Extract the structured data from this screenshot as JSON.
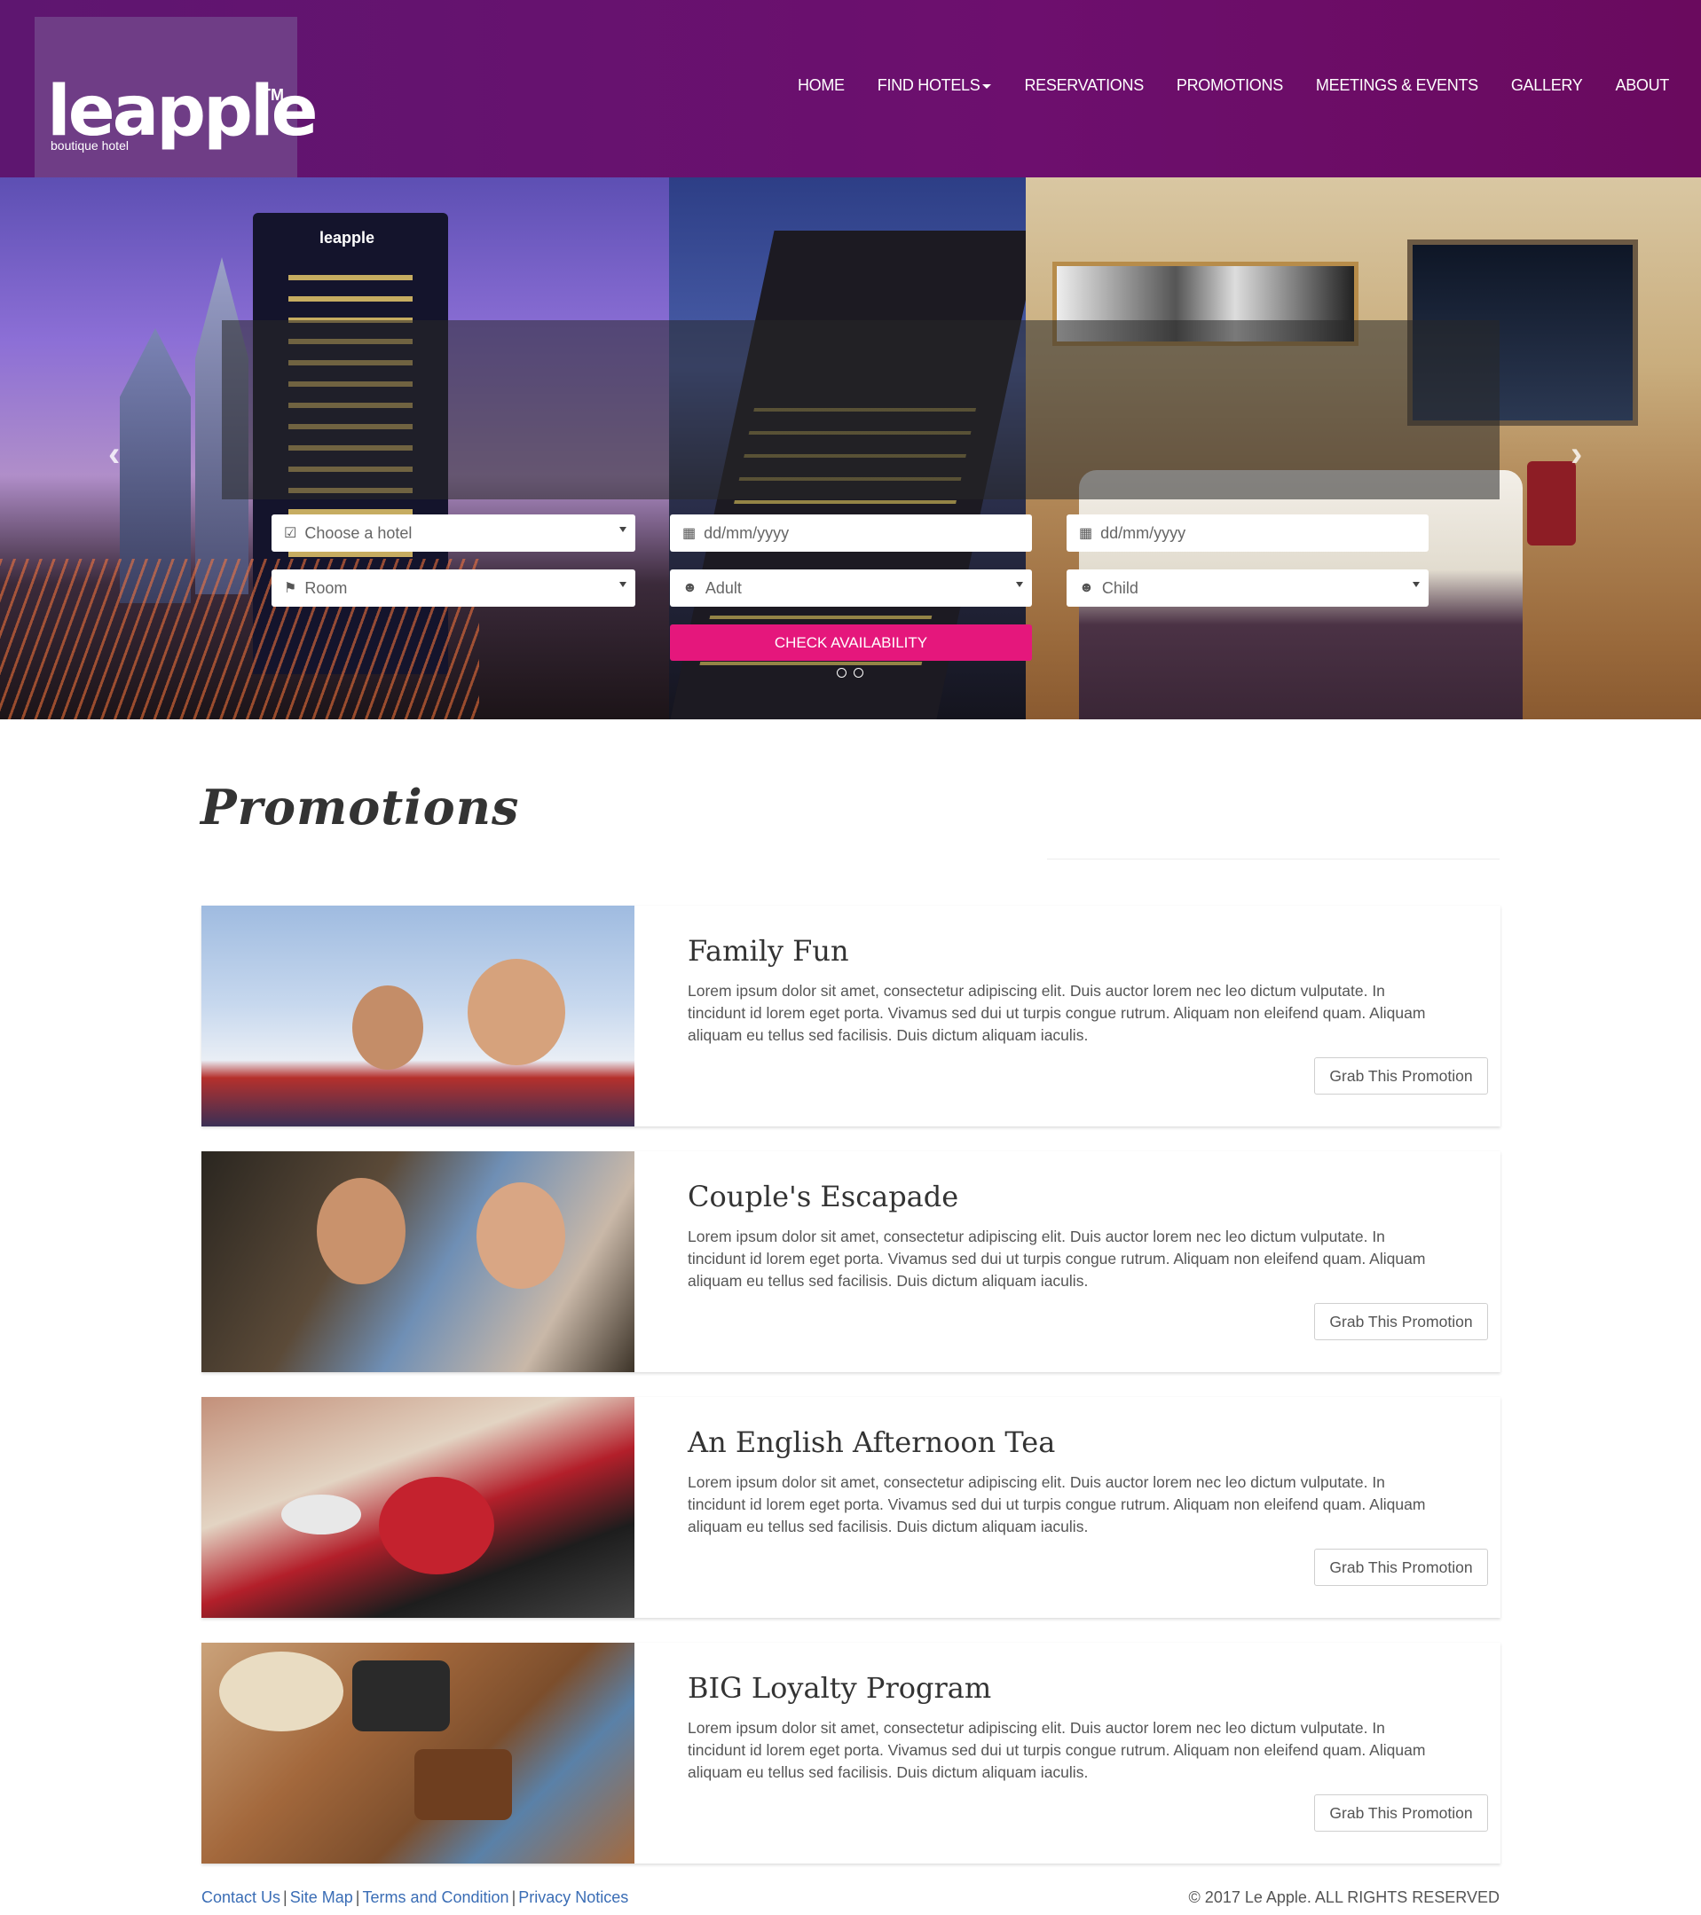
{
  "brand": {
    "name": "leapple",
    "tm": "TM",
    "tagline": "boutique hotel"
  },
  "nav": {
    "items": [
      {
        "label": "HOME"
      },
      {
        "label": "FIND HOTELS",
        "dropdown": true
      },
      {
        "label": "RESERVATIONS"
      },
      {
        "label": "PROMOTIONS"
      },
      {
        "label": "MEETINGS & EVENTS"
      },
      {
        "label": "GALLERY"
      },
      {
        "label": "ABOUT"
      }
    ]
  },
  "hero": {
    "tower_sign": "leapple",
    "slides": 2,
    "prev_icon": "chevron-left-icon",
    "next_icon": "chevron-right-icon"
  },
  "booking": {
    "hotel_placeholder": "Choose a hotel",
    "checkin_placeholder": "dd/mm/yyyy",
    "checkout_placeholder": "dd/mm/yyyy",
    "room_placeholder": "Room",
    "adult_placeholder": "Adult",
    "child_placeholder": "Child",
    "submit_label": "CHECK AVAILABILITY",
    "submit_color": "#e5177c"
  },
  "promotions": {
    "heading": "Promotions",
    "cards": [
      {
        "title": "Family Fun",
        "text": "Lorem ipsum dolor sit amet, consectetur adipiscing elit. Duis auctor lorem nec leo dictum vulputate. In tincidunt id lorem eget porta. Vivamus sed dui ut turpis congue rutrum. Aliquam non eleifend quam. Aliquam aliquam eu tellus sed facilisis. Duis dictum aliquam iaculis.",
        "button": "Grab This Promotion"
      },
      {
        "title": "Couple's Escapade",
        "text": "Lorem ipsum dolor sit amet, consectetur adipiscing elit. Duis auctor lorem nec leo dictum vulputate. In tincidunt id lorem eget porta. Vivamus sed dui ut turpis congue rutrum. Aliquam non eleifend quam. Aliquam aliquam eu tellus sed facilisis. Duis dictum aliquam iaculis.",
        "button": "Grab This Promotion"
      },
      {
        "title": "An English Afternoon Tea",
        "text": "Lorem ipsum dolor sit amet, consectetur adipiscing elit. Duis auctor lorem nec leo dictum vulputate. In tincidunt id lorem eget porta. Vivamus sed dui ut turpis congue rutrum. Aliquam non eleifend quam. Aliquam aliquam eu tellus sed facilisis. Duis dictum aliquam iaculis.",
        "button": "Grab This Promotion"
      },
      {
        "title": "BIG Loyalty Program",
        "text": "Lorem ipsum dolor sit amet, consectetur adipiscing elit. Duis auctor lorem nec leo dictum vulputate. In tincidunt id lorem eget porta. Vivamus sed dui ut turpis congue rutrum. Aliquam non eleifend quam. Aliquam aliquam eu tellus sed facilisis. Duis dictum aliquam iaculis.",
        "button": "Grab This Promotion"
      }
    ]
  },
  "footer": {
    "links": [
      "Contact Us",
      "Site Map",
      "Terms and Condition",
      "Privacy Notices"
    ],
    "separator": "|",
    "copyright": "© 2017 Le Apple. ALL RIGHTS RESERVED"
  },
  "colors": {
    "header": "#6d0f6e",
    "accent": "#e5177c",
    "link": "#3a6db5"
  }
}
